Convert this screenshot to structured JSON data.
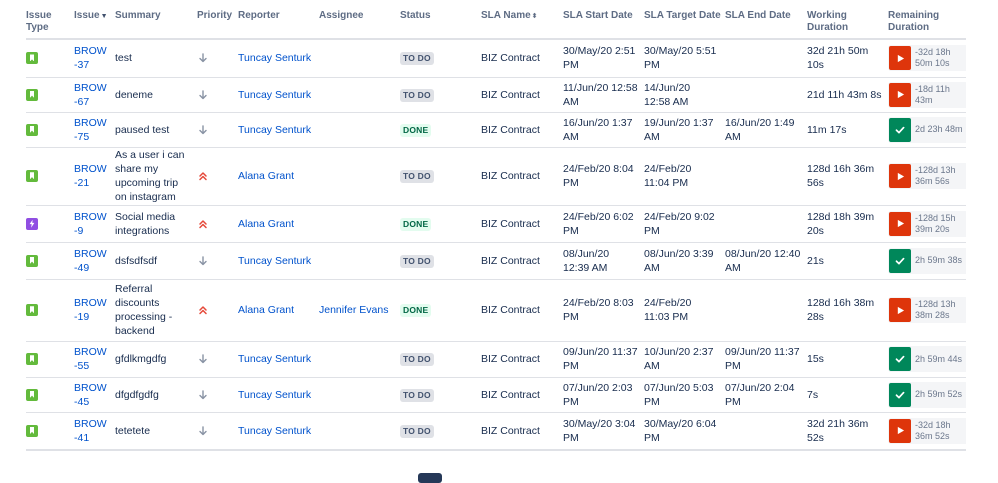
{
  "columns": {
    "issue_type": "Issue Type",
    "issue": "Issue",
    "summary": "Summary",
    "priority": "Priority",
    "reporter": "Reporter",
    "assignee": "Assignee",
    "status": "Status",
    "sla_name": "SLA Name",
    "sla_start": "SLA Start Date",
    "sla_target": "SLA Target Date",
    "sla_end": "SLA End Date",
    "working_duration": "Working Duration",
    "remaining_duration": "Remaining Duration"
  },
  "colors": {
    "link": "#0052cc",
    "sla_running": "#de350b",
    "sla_met": "#00875a",
    "story": "#63ba3c",
    "epic": "#904ee2",
    "priority_high": "#e5493a",
    "priority_low": "#8993a4"
  },
  "rows": [
    {
      "type": "story-icon",
      "key": "BROW-37",
      "summary": "test",
      "priority": "low",
      "reporter": "Tuncay Senturk",
      "assignee": "",
      "status": "TO DO",
      "sla_name": "BIZ Contract",
      "start": "30/May/20 2:51 PM",
      "target": "30/May/20 5:51 PM",
      "end": "",
      "working": "32d 21h 50m 10s",
      "remaining": "-32d 18h 50m 10s",
      "sla_state": "running"
    },
    {
      "type": "story-icon",
      "key": "BROW-67",
      "summary": "deneme",
      "priority": "low",
      "reporter": "Tuncay Senturk",
      "assignee": "",
      "status": "TO DO",
      "sla_name": "BIZ Contract",
      "start": "11/Jun/20 12:58 AM",
      "target": "14/Jun/20 12:58 AM",
      "end": "",
      "working": "21d 11h 43m 8s",
      "remaining": "-18d 11h 43m",
      "sla_state": "running"
    },
    {
      "type": "story-icon",
      "key": "BROW-75",
      "summary": "paused test",
      "priority": "low",
      "reporter": "Tuncay Senturk",
      "assignee": "",
      "status": "DONE",
      "sla_name": "BIZ Contract",
      "start": "16/Jun/20 1:37 AM",
      "target": "19/Jun/20 1:37 AM",
      "end": "16/Jun/20 1:49 AM",
      "working": "11m 17s",
      "remaining": "2d 23h 48m",
      "sla_state": "met"
    },
    {
      "type": "story-icon",
      "key": "BROW-21",
      "summary": "As a user i can share my upcoming trip on instagram",
      "priority": "high",
      "reporter": "Alana Grant",
      "assignee": "",
      "status": "TO DO",
      "sla_name": "BIZ Contract",
      "start": "24/Feb/20 8:04 PM",
      "target": "24/Feb/20 11:04 PM",
      "end": "",
      "working": "128d 16h 36m 56s",
      "remaining": "-128d 13h 36m 56s",
      "sla_state": "running"
    },
    {
      "type": "epic-icon",
      "key": "BROW-9",
      "summary": "Social media integrations",
      "priority": "high",
      "reporter": "Alana Grant",
      "assignee": "",
      "status": "DONE",
      "sla_name": "BIZ Contract",
      "start": "24/Feb/20 6:02 PM",
      "target": "24/Feb/20 9:02 PM",
      "end": "",
      "working": "128d 18h 39m 20s",
      "remaining": "-128d 15h 39m 20s",
      "sla_state": "running"
    },
    {
      "type": "story-icon",
      "key": "BROW-49",
      "summary": "dsfsdfsdf",
      "priority": "low",
      "reporter": "Tuncay Senturk",
      "assignee": "",
      "status": "TO DO",
      "sla_name": "BIZ Contract",
      "start": "08/Jun/20 12:39 AM",
      "target": "08/Jun/20 3:39 AM",
      "end": "08/Jun/20 12:40 AM",
      "working": "21s",
      "remaining": "2h 59m 38s",
      "sla_state": "met"
    },
    {
      "type": "story-icon",
      "key": "BROW-19",
      "summary": "Referral discounts processing - backend",
      "priority": "high",
      "reporter": "Alana Grant",
      "assignee": "Jennifer Evans",
      "status": "DONE",
      "sla_name": "BIZ Contract",
      "start": "24/Feb/20 8:03 PM",
      "target": "24/Feb/20 11:03 PM",
      "end": "",
      "working": "128d 16h 38m 28s",
      "remaining": "-128d 13h 38m 28s",
      "sla_state": "running"
    },
    {
      "type": "story-icon",
      "key": "BROW-55",
      "summary": "gfdlkmgdfg",
      "priority": "low",
      "reporter": "Tuncay Senturk",
      "assignee": "",
      "status": "TO DO",
      "sla_name": "BIZ Contract",
      "start": "09/Jun/20 11:37 PM",
      "target": "10/Jun/20 2:37 AM",
      "end": "09/Jun/20 11:37 PM",
      "working": "15s",
      "remaining": "2h 59m 44s",
      "sla_state": "met"
    },
    {
      "type": "story-icon",
      "key": "BROW-45",
      "summary": "dfgdfgdfg",
      "priority": "low",
      "reporter": "Tuncay Senturk",
      "assignee": "",
      "status": "TO DO",
      "sla_name": "BIZ Contract",
      "start": "07/Jun/20 2:03 PM",
      "target": "07/Jun/20 5:03 PM",
      "end": "07/Jun/20 2:04 PM",
      "working": "7s",
      "remaining": "2h 59m 52s",
      "sla_state": "met"
    },
    {
      "type": "story-icon",
      "key": "BROW-41",
      "summary": "tetetete",
      "priority": "low",
      "reporter": "Tuncay Senturk",
      "assignee": "",
      "status": "TO DO",
      "sla_name": "BIZ Contract",
      "start": "30/May/20 3:04 PM",
      "target": "30/May/20 6:04 PM",
      "end": "",
      "working": "32d 21h 36m 52s",
      "remaining": "-32d 18h 36m 52s",
      "sla_state": "running"
    }
  ]
}
